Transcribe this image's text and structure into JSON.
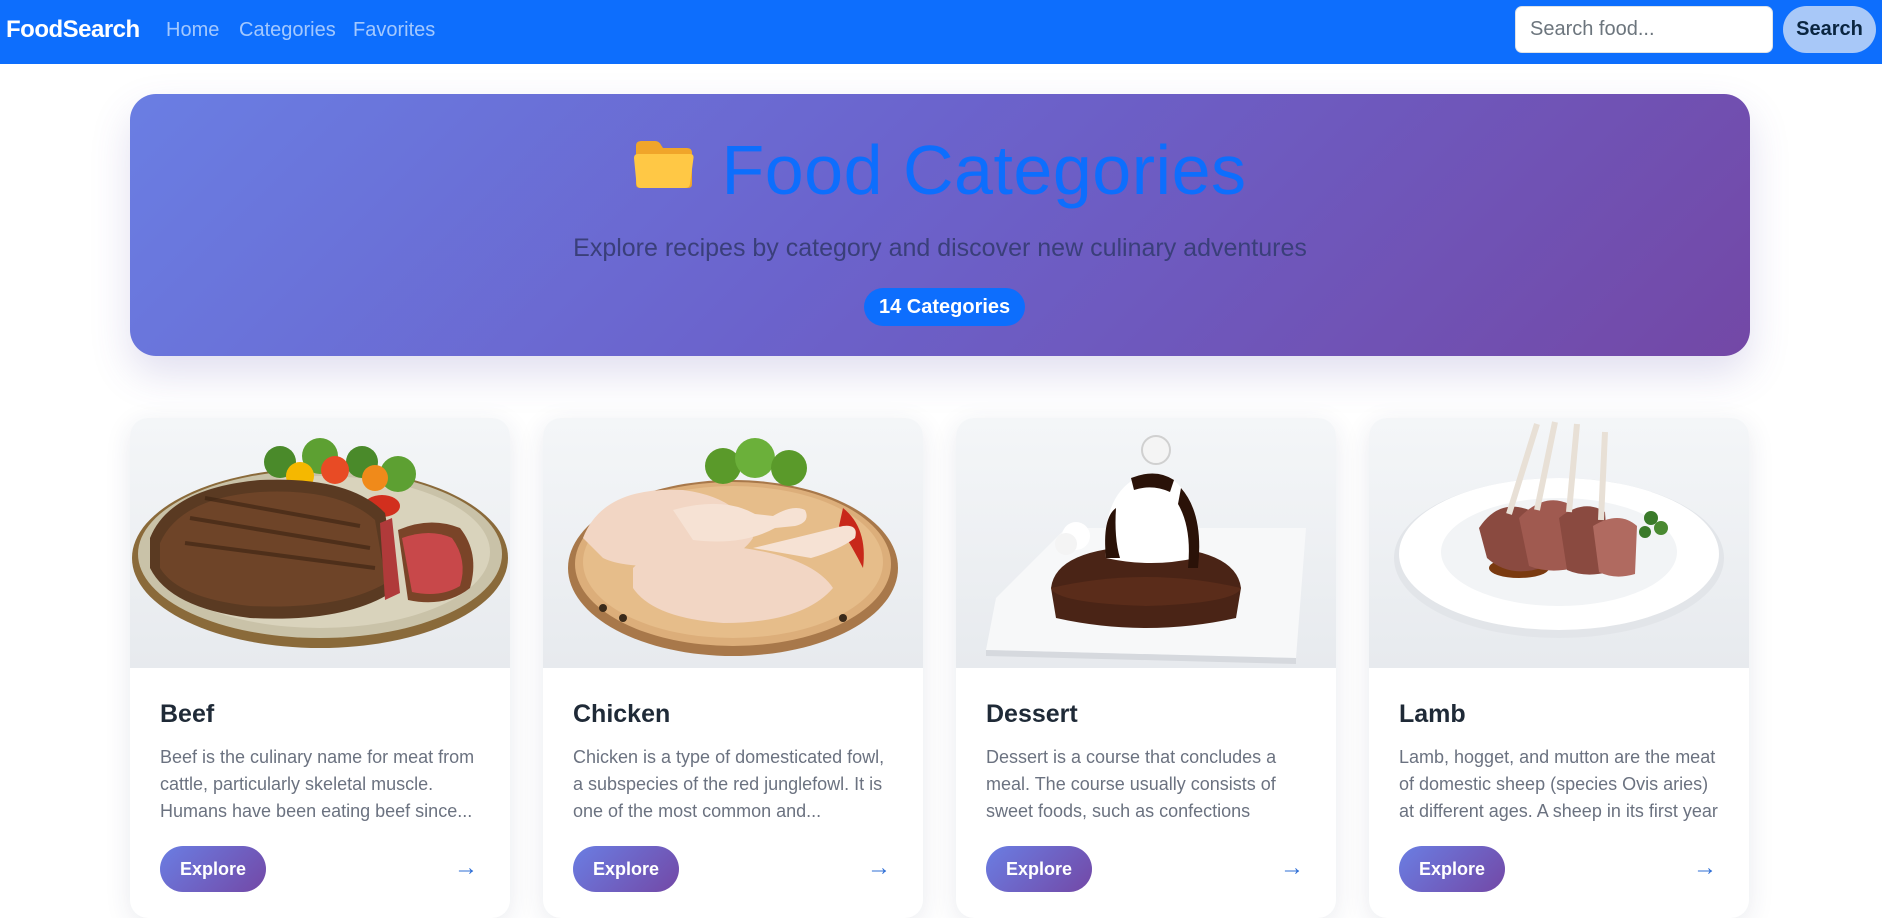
{
  "navbar": {
    "brand": "FoodSearch",
    "links": [
      "Home",
      "Categories",
      "Favorites"
    ],
    "search_placeholder": "Search food...",
    "search_label": "Search"
  },
  "hero": {
    "icon": "folder-icon",
    "title": "Food Categories",
    "subtitle": "Explore recipes by category and discover new culinary adventures",
    "badge": "14 Categories"
  },
  "cards": [
    {
      "title": "Beef",
      "description": "Beef is the culinary name for meat from cattle, particularly skeletal muscle. Humans have been eating beef since...",
      "button": "Explore",
      "arrow": "→",
      "image": "beef-steak-image"
    },
    {
      "title": "Chicken",
      "description": "Chicken is a type of domesticated fowl, a subspecies of the red junglefowl. It is one of the most common and...",
      "button": "Explore",
      "arrow": "→",
      "image": "chicken-legs-image"
    },
    {
      "title": "Dessert",
      "description": "Dessert is a course that concludes a meal. The course usually consists of sweet foods, such as confections dishe...",
      "button": "Explore",
      "arrow": "→",
      "image": "chocolate-dessert-image"
    },
    {
      "title": "Lamb",
      "description": "Lamb, hogget, and mutton are the meat of domestic sheep (species Ovis aries) at different ages. A sheep in its first year i...",
      "button": "Explore",
      "arrow": "→",
      "image": "lamb-chops-image"
    }
  ],
  "colors": {
    "navbar": "#0d6efd",
    "hero_gradient_start": "#6a7ee3",
    "hero_gradient_end": "#7348a6",
    "title_blue": "#0d6efd"
  }
}
